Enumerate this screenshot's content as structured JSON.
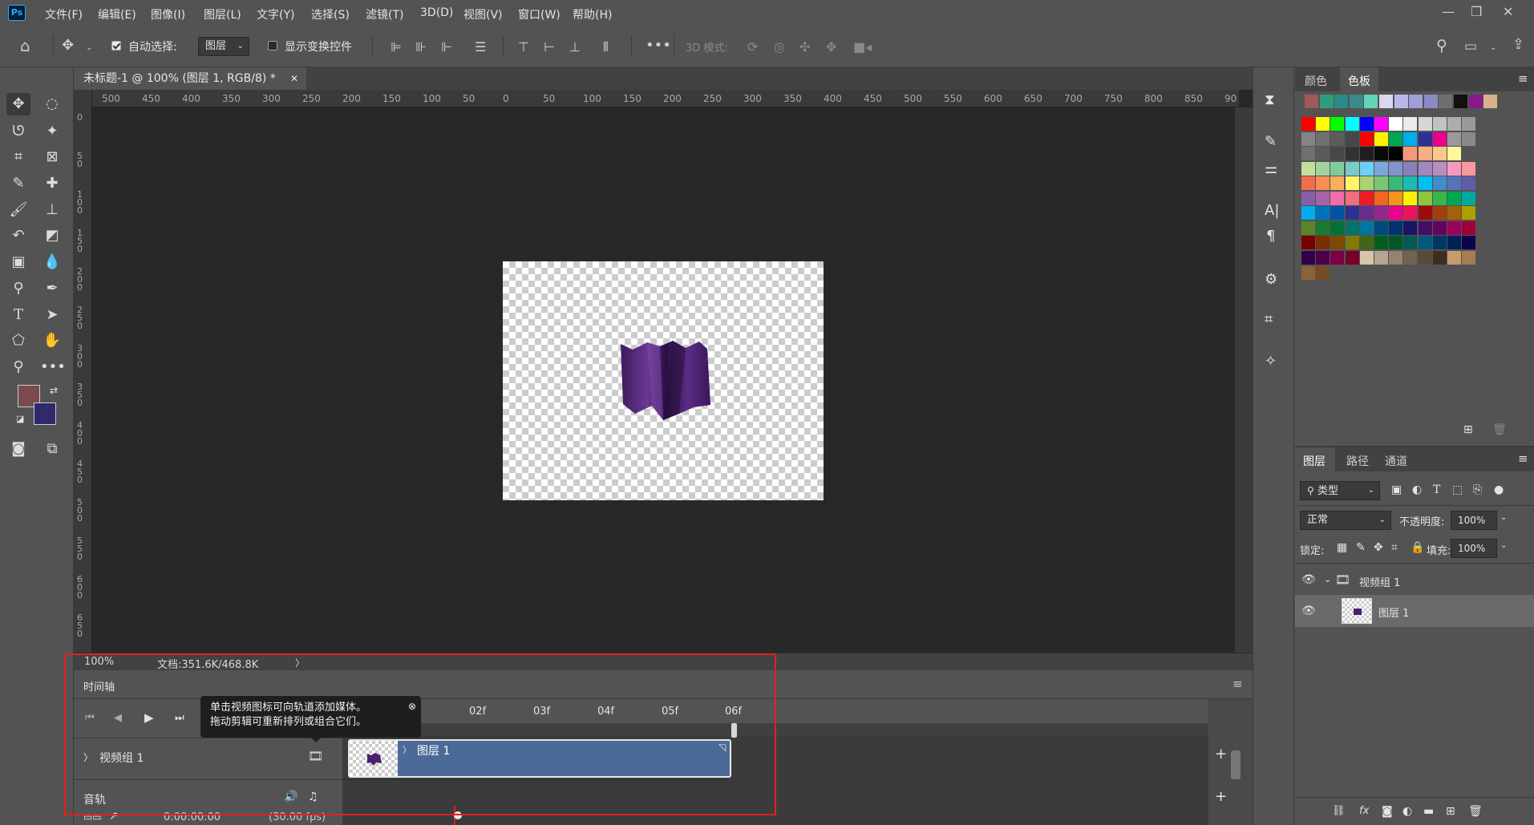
{
  "menubar": {
    "logo": "Ps",
    "items": [
      "文件(F)",
      "编辑(E)",
      "图像(I)",
      "图层(L)",
      "文字(Y)",
      "选择(S)",
      "滤镜(T)",
      "3D(D)",
      "视图(V)",
      "窗口(W)",
      "帮助(H)"
    ]
  },
  "options": {
    "auto_select_label": "自动选择:",
    "auto_select_target": "图层",
    "show_transform_label": "显示变换控件",
    "mode_3d_label": "3D 模式:"
  },
  "document": {
    "tab_title": "未标题-1 @ 100% (图层 1, RGB/8) *",
    "ruler_h": [
      "500",
      "450",
      "400",
      "350",
      "300",
      "250",
      "200",
      "150",
      "100",
      "50",
      "0",
      "50",
      "100",
      "150",
      "200",
      "250",
      "300",
      "350",
      "400",
      "450",
      "500",
      "550",
      "600",
      "650",
      "700",
      "750",
      "800",
      "850",
      "90"
    ],
    "ruler_v": [
      "0",
      "50",
      "100",
      "150",
      "200",
      "250",
      "300",
      "350",
      "400",
      "450",
      "500",
      "550",
      "600",
      "650"
    ],
    "zoom": "100%",
    "doc_info": "文档:351.6K/468.8K"
  },
  "timeline": {
    "title": "时间轴",
    "frames": [
      "02f",
      "03f",
      "04f",
      "05f",
      "06f"
    ],
    "tooltip_line1": "单击视频图标可向轨道添加媒体。",
    "tooltip_line2": "拖动剪辑可重新排列或组合它们。",
    "video_group": "视频组 1",
    "clip_label": "图层 1",
    "audio_track": "音轨",
    "timecode": "0:00:00:00",
    "fps": "(30.00 fps)"
  },
  "color_panel": {
    "tabs": [
      "颜色",
      "色板"
    ],
    "active_tab": "色板"
  },
  "layers_panel": {
    "tabs": [
      "图层",
      "路径",
      "通道"
    ],
    "filter_label": "类型",
    "blend_mode": "正常",
    "opacity_label": "不透明度:",
    "opacity_value": "100%",
    "lock_label": "锁定:",
    "fill_label": "填充:",
    "fill_value": "100%",
    "layers": [
      {
        "name": "视频组 1"
      },
      {
        "name": "图层 1"
      }
    ]
  },
  "colors": {
    "foreground": "#7a4a4d",
    "background": "#2f2a6a",
    "clip": "#4c6a97",
    "annotation": "#e0211f"
  }
}
